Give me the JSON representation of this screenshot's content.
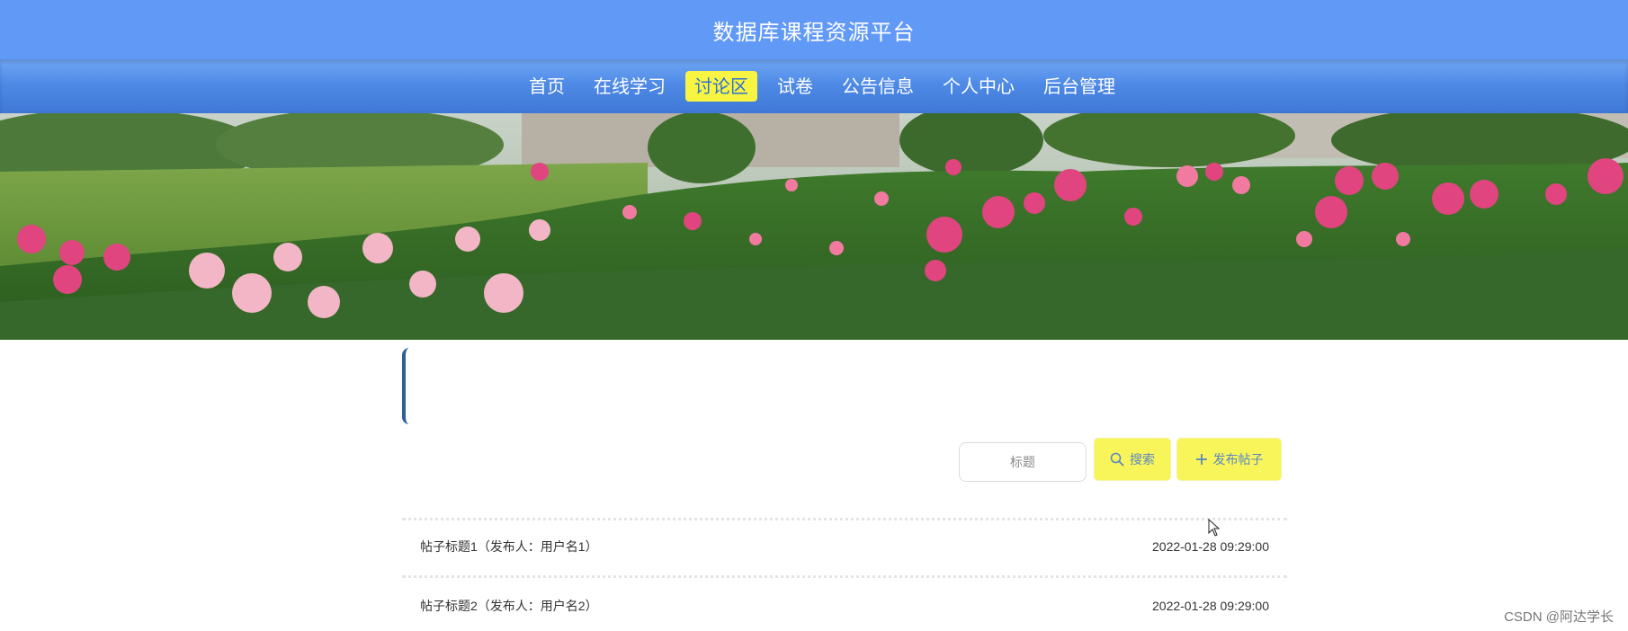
{
  "header": {
    "title": "数据库课程资源平台"
  },
  "nav": {
    "items": [
      {
        "label": "首页",
        "active": false
      },
      {
        "label": "在线学习",
        "active": false
      },
      {
        "label": "讨论区",
        "active": true
      },
      {
        "label": "试卷",
        "active": false
      },
      {
        "label": "公告信息",
        "active": false
      },
      {
        "label": "个人中心",
        "active": false
      },
      {
        "label": "后台管理",
        "active": false
      }
    ]
  },
  "search": {
    "placeholder": "标题",
    "search_label": "搜索",
    "post_label": "发布帖子"
  },
  "posts": [
    {
      "title": "帖子标题1（发布人：用户名1）",
      "time": "2022-01-28 09:29:00"
    },
    {
      "title": "帖子标题2（发布人：用户名2）",
      "time": "2022-01-28 09:29:00"
    }
  ],
  "watermark": "CSDN @阿达学长",
  "colors": {
    "header_bg": "#6199f7",
    "nav_bg": "#4f8ae6",
    "nav_active_bg": "#f7f542",
    "button_bg": "#f8f55b",
    "accent": "#2f6096"
  }
}
